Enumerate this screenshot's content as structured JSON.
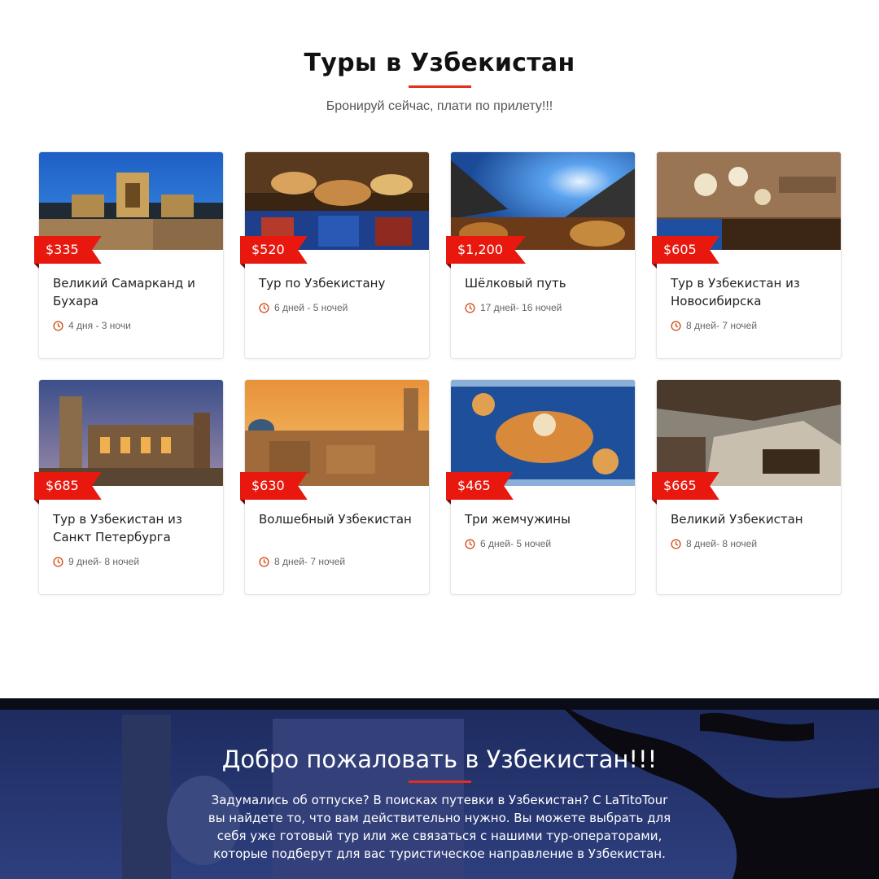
{
  "section": {
    "title": "Туры в Узбекистан",
    "subtitle": "Бронируй сейчас, плати по прилету!!!"
  },
  "tours": [
    {
      "price": "$335",
      "name": "Великий Самарканд и Бухара",
      "duration": "4 дня - 3 ночи"
    },
    {
      "price": "$520",
      "name": "Тур по Узбекистану",
      "duration": "6 дней - 5 ночей"
    },
    {
      "price": "$1,200",
      "name": "Шёлковый путь",
      "duration": "17 дней- 16 ночей"
    },
    {
      "price": "$605",
      "name": "Тур в Узбекистан из Новосибирска",
      "duration": "8 дней- 7 ночей"
    },
    {
      "price": "$685",
      "name": "Тур в Узбекистан из Санкт Петербурга",
      "duration": "9 дней- 8 ночей"
    },
    {
      "price": "$630",
      "name": "Волшебный Узбекистан",
      "duration": "8 дней- 7 ночей"
    },
    {
      "price": "$465",
      "name": "Три жемчужины",
      "duration": "6 дней- 5 ночей"
    },
    {
      "price": "$665",
      "name": "Великий Узбекистан",
      "duration": "8 дней- 8 ночей"
    }
  ],
  "banner": {
    "title": "Добро пожаловать в Узбекистан!!!",
    "text": "Задумались об отпуске? В поисках путевки в Узбекистан? С LaTitoTour вы найдете то, что вам действительно нужно. Вы можете выбрать для себя уже готовый тур или же связаться с нашими тур-операторами, которые подберут для вас туристическое направление в Узбекистан."
  },
  "colors": {
    "accent": "#e8180f",
    "text": "#222222",
    "muted": "#666666"
  },
  "icons": {
    "duration": "clock-icon"
  }
}
